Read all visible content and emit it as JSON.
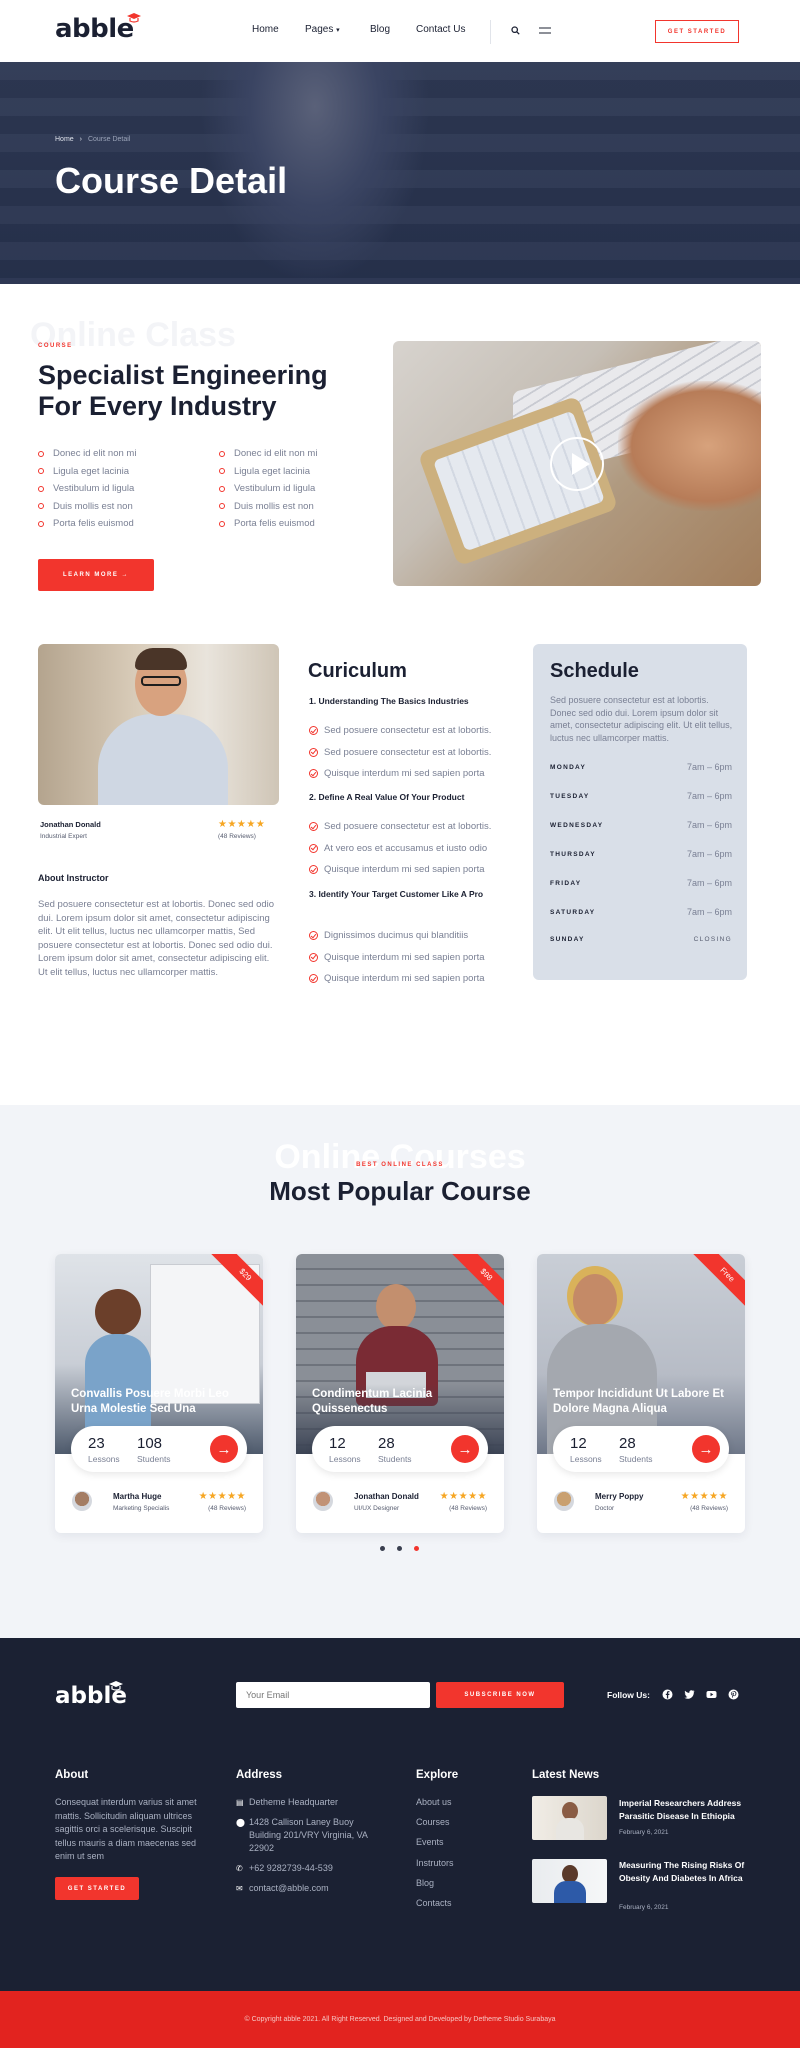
{
  "header": {
    "logo": "abble",
    "nav": [
      "Home",
      "Pages",
      "Blog",
      "Contact Us"
    ],
    "cta": "GET STARTED"
  },
  "hero": {
    "breadcrumb_home": "Home",
    "breadcrumb_sep": "›",
    "breadcrumb_current": "Course Detail",
    "title": "Course Detail"
  },
  "course": {
    "ghost": "Online Class",
    "tag": "COURSE",
    "title_line1": "Specialist Engineering",
    "title_line2": "For Every Industry",
    "list_left": [
      "Donec id elit non mi",
      "Ligula eget lacinia",
      "Vestibulum id ligula",
      "Duis mollis est non",
      "Porta felis euismod"
    ],
    "list_right": [
      "Donec id elit non mi",
      "Ligula eget lacinia",
      "Vestibulum id ligula",
      "Duis mollis est non",
      "Porta felis euismod"
    ],
    "button": "LEARN MORE →"
  },
  "instructor": {
    "name": "Jonathan Donald",
    "role": "Industrial Expert",
    "stars": "★★★★★",
    "reviews": "(48 Reviews)",
    "about_title": "About Instructor",
    "about_text": "Sed posuere consectetur est at lobortis. Donec sed odio dui. Lorem ipsum dolor sit amet, consectetur adipiscing elit. Ut elit tellus, luctus nec ullamcorper mattis, Sed posuere consectetur est at lobortis. Donec sed odio dui. Lorem ipsum dolor sit amet, consectetur adipiscing elit. Ut elit tellus, luctus nec ullamcorper mattis."
  },
  "curriculum": {
    "title": "Curiculum",
    "s1_title": "1. Understanding The Basics Industries",
    "s1_items": [
      "Sed posuere consectetur est at lobortis.",
      "Sed posuere consectetur est at lobortis.",
      "Quisque interdum mi sed sapien porta"
    ],
    "s2_title": "2. Define A Real Value Of Your Product",
    "s2_items": [
      "Sed posuere consectetur est at lobortis.",
      "At vero eos et accusamus et iusto odio",
      "Quisque interdum mi sed sapien porta"
    ],
    "s3_title": "3. Identify Your Target Customer Like A Pro",
    "s3_items": [
      "Dignissimos ducimus qui blanditiis",
      "Quisque interdum mi sed sapien porta",
      "Quisque interdum mi sed sapien porta"
    ]
  },
  "schedule": {
    "title": "Schedule",
    "text": "Sed posuere consectetur est at lobortis. Donec sed odio dui. Lorem ipsum dolor sit amet, consectetur adipiscing elit. Ut elit tellus, luctus nec ullamcorper mattis.",
    "rows": [
      {
        "day": "MONDAY",
        "time": "7am – 6pm"
      },
      {
        "day": "TUESDAY",
        "time": "7am – 6pm"
      },
      {
        "day": "WEDNESDAY",
        "time": "7am – 6pm"
      },
      {
        "day": "THURSDAY",
        "time": "7am – 6pm"
      },
      {
        "day": "FRIDAY",
        "time": "7am – 6pm"
      },
      {
        "day": "SATURDAY",
        "time": "7am – 6pm"
      },
      {
        "day": "SUNDAY",
        "time": "CLOSING"
      }
    ]
  },
  "popular": {
    "ghost": "Online Courses",
    "tag": "BEST ONLINE CLASS",
    "title": "Most Popular Course",
    "cards": [
      {
        "price": "$29",
        "title": "Convallis Posuere Morbi Leo Urna Molestie Sed Una",
        "lessons": "23",
        "lessons_label": "Lessons",
        "students": "108",
        "students_label": "Students",
        "name": "Martha Huge",
        "role": "Marketing Specialis",
        "stars": "★★★★★",
        "reviews": "(48 Reviews)"
      },
      {
        "price": "$98",
        "title": "Condimentum Lacinia Quissenectus",
        "lessons": "12",
        "lessons_label": "Lessons",
        "students": "28",
        "students_label": "Students",
        "name": "Jonathan Donald",
        "role": "UI/UX Designer",
        "stars": "★★★★★",
        "reviews": "(48 Reviews)"
      },
      {
        "price": "Free",
        "title": "Tempor Incididunt Ut Labore Et Dolore Magna Aliqua",
        "lessons": "12",
        "lessons_label": "Lessons",
        "students": "28",
        "students_label": "Students",
        "name": "Merry Poppy",
        "role": "Doctor",
        "stars": "★★★★★",
        "reviews": "(48 Reviews)"
      }
    ],
    "arrow": "→"
  },
  "footer": {
    "logo": "abble",
    "email_placeholder": "Your Email",
    "subscribe": "SUBSCRIBE NOW",
    "follow": "Follow Us:",
    "about_title": "About",
    "about_text": "Consequat interdum varius sit amet mattis. Sollicitudin aliquam ultrices sagittis orci a scelerisque. Suscipit tellus mauris a diam maecenas sed enim ut sem",
    "about_btn": "GET STARTED",
    "address_title": "Address",
    "hq": "Detheme Headquarter",
    "street": "1428 Callison Laney Buoy Building 201/VRY Virginia, VA 22902",
    "phone": "+62 9282739-44-539",
    "email": "contact@abble.com",
    "explore_title": "Explore",
    "explore": [
      "About us",
      "Courses",
      "Events",
      "Instrutors",
      "Blog",
      "Contacts"
    ],
    "news_title": "Latest News",
    "news": [
      {
        "title": "Imperial Researchers Address Parasitic Disease In Ethiopia",
        "date": "February 6, 2021"
      },
      {
        "title": "Measuring The Rising Risks Of Obesity And Diabetes In Africa",
        "date": "February 6, 2021"
      }
    ],
    "copyright": "© Copyright abble 2021. All Right Reserved. Designed and Developed by Detheme Studio Surabaya"
  },
  "colors": {
    "accent": "#f2352d",
    "navy": "#1b2133",
    "hero": "#2e3954"
  }
}
